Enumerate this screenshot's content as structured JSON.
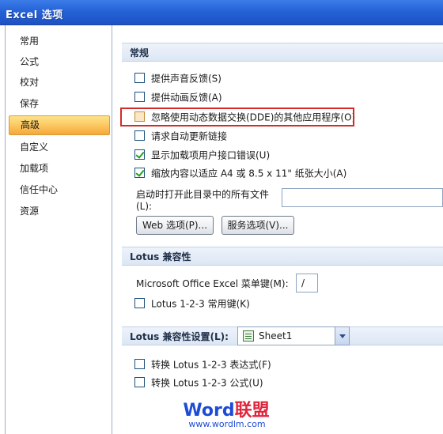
{
  "window": {
    "title": "Excel 选项"
  },
  "sidebar": {
    "items": [
      {
        "label": "常用",
        "active": false
      },
      {
        "label": "公式",
        "active": false
      },
      {
        "label": "校对",
        "active": false
      },
      {
        "label": "保存",
        "active": false
      },
      {
        "label": "高级",
        "active": true
      },
      {
        "label": "自定义",
        "active": false
      },
      {
        "label": "加载项",
        "active": false
      },
      {
        "label": "信任中心",
        "active": false
      },
      {
        "label": "资源",
        "active": false
      }
    ]
  },
  "general": {
    "header": "常规",
    "options": [
      {
        "label": "提供声音反馈(S)",
        "checked": false
      },
      {
        "label": "提供动画反馈(A)",
        "checked": false
      },
      {
        "label": "忽略使用动态数据交换(DDE)的其他应用程序(O)",
        "checked": false,
        "highlighted": true
      },
      {
        "label": "请求自动更新链接",
        "checked": false
      },
      {
        "label": "显示加载项用户接口错误(U)",
        "checked": true
      },
      {
        "label": "缩放内容以适应 A4 或 8.5 x 11\" 纸张大小(A)",
        "checked": true
      }
    ],
    "startup_label_line1": "启动时打开此目录中的所有文件",
    "startup_label_line2": "(L):",
    "startup_value": "",
    "web_options_button": "Web 选项(P)...",
    "service_options_button": "服务选项(V)..."
  },
  "lotus_compat": {
    "header": "Lotus 兼容性",
    "menu_key_label": "Microsoft Office Excel 菜单键(M):",
    "menu_key_value": "/",
    "nav_keys_label": "Lotus 1-2-3 常用键(K)",
    "nav_keys_checked": false
  },
  "lotus_settings": {
    "header_label": "Lotus 兼容性设置(L):",
    "sheet_value": "Sheet1",
    "options": [
      {
        "label": "转换 Lotus 1-2-3 表达式(F)",
        "checked": false
      },
      {
        "label": "转换 Lotus 1-2-3 公式(U)",
        "checked": false
      }
    ]
  },
  "watermark": {
    "brand_latin": "Word",
    "brand_cn": "联盟",
    "url": "www.wordlm.com"
  }
}
